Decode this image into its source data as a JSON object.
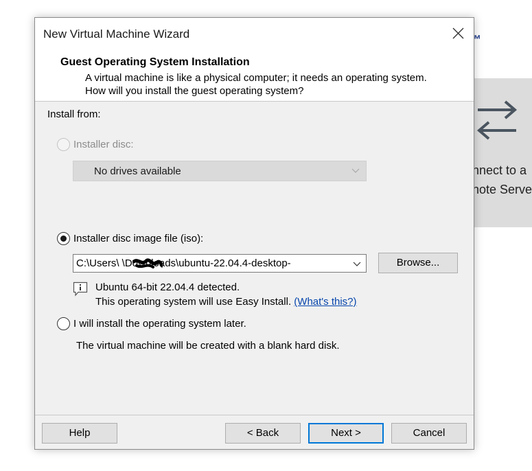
{
  "background": {
    "tm_mark": "™",
    "panel_line1": "nnect to a",
    "panel_line2": "note Serve"
  },
  "dialog": {
    "title": "New Virtual Machine Wizard",
    "header_title": "Guest Operating System Installation",
    "header_description": "A virtual machine is like a physical computer; it needs an operating system. How will you install the guest operating system?",
    "install_from_label": "Install from:",
    "option_disc": {
      "label": "Installer disc:",
      "selected": false,
      "enabled": false,
      "dropdown_value": "No drives available"
    },
    "option_iso": {
      "label": "Installer disc image file (iso):",
      "selected": true,
      "path_value": "C:\\Users\\      \\Downloads\\ubuntu-22.04.4-desktop-",
      "browse_label": "Browse...",
      "detected_line": "Ubuntu 64-bit 22.04.4 detected.",
      "easy_install_line": "This operating system will use Easy Install.",
      "whats_this_link": "(What's this?)"
    },
    "option_later": {
      "label": "I will install the operating system later.",
      "selected": false,
      "description": "The virtual machine will be created with a blank hard disk."
    },
    "buttons": {
      "help": "Help",
      "back": "< Back",
      "next": "Next >",
      "cancel": "Cancel"
    }
  },
  "colors": {
    "dialog_bg": "#f0f0f0",
    "link": "#0645ad",
    "default_button_border": "#0078d7",
    "disabled_text": "#8c8c8c"
  },
  "icons": [
    "close-icon",
    "chevron-down-icon",
    "info-icon",
    "swap-arrows-icon"
  ]
}
